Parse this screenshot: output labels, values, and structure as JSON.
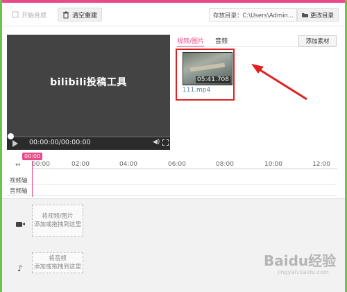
{
  "toolbar": {
    "start_label": "开始合成",
    "clear_label": "清空重建",
    "path_text": "存放目录：C:\\Users\\Admin...",
    "change_dir_label": "更改目录"
  },
  "preview": {
    "logo_text": "bilibili投稿工具",
    "time_text": "00:00:00/00:00:00",
    "progress": 0
  },
  "library": {
    "tabs": [
      {
        "label": "视频/图片",
        "active": true
      },
      {
        "label": "音频",
        "active": false
      }
    ],
    "add_label": "添加素材",
    "items": [
      {
        "name": "111.mp4",
        "duration": "05:41.708"
      }
    ]
  },
  "timeline": {
    "playhead_label": "00:00",
    "zoom_icon": "↔",
    "ticks": [
      "00:00",
      "02:00",
      "04:00",
      "06:00",
      "08:00",
      "10:00",
      "12:00"
    ],
    "video_track": "视频轴",
    "audio_track": "音频轴"
  },
  "drop_zones": {
    "video_line1": "将视频/图片",
    "video_line2": "添加或拖拽到这里",
    "audio_line1": "将音频",
    "audio_line2": "添加或拖拽到这里"
  },
  "watermark": {
    "text": "Baidu经验",
    "sub": "jingyan.baidu.com"
  },
  "colors": {
    "accent": "#e84a8a",
    "highlight": "#e02020",
    "frame_side": "#6cc34a"
  }
}
